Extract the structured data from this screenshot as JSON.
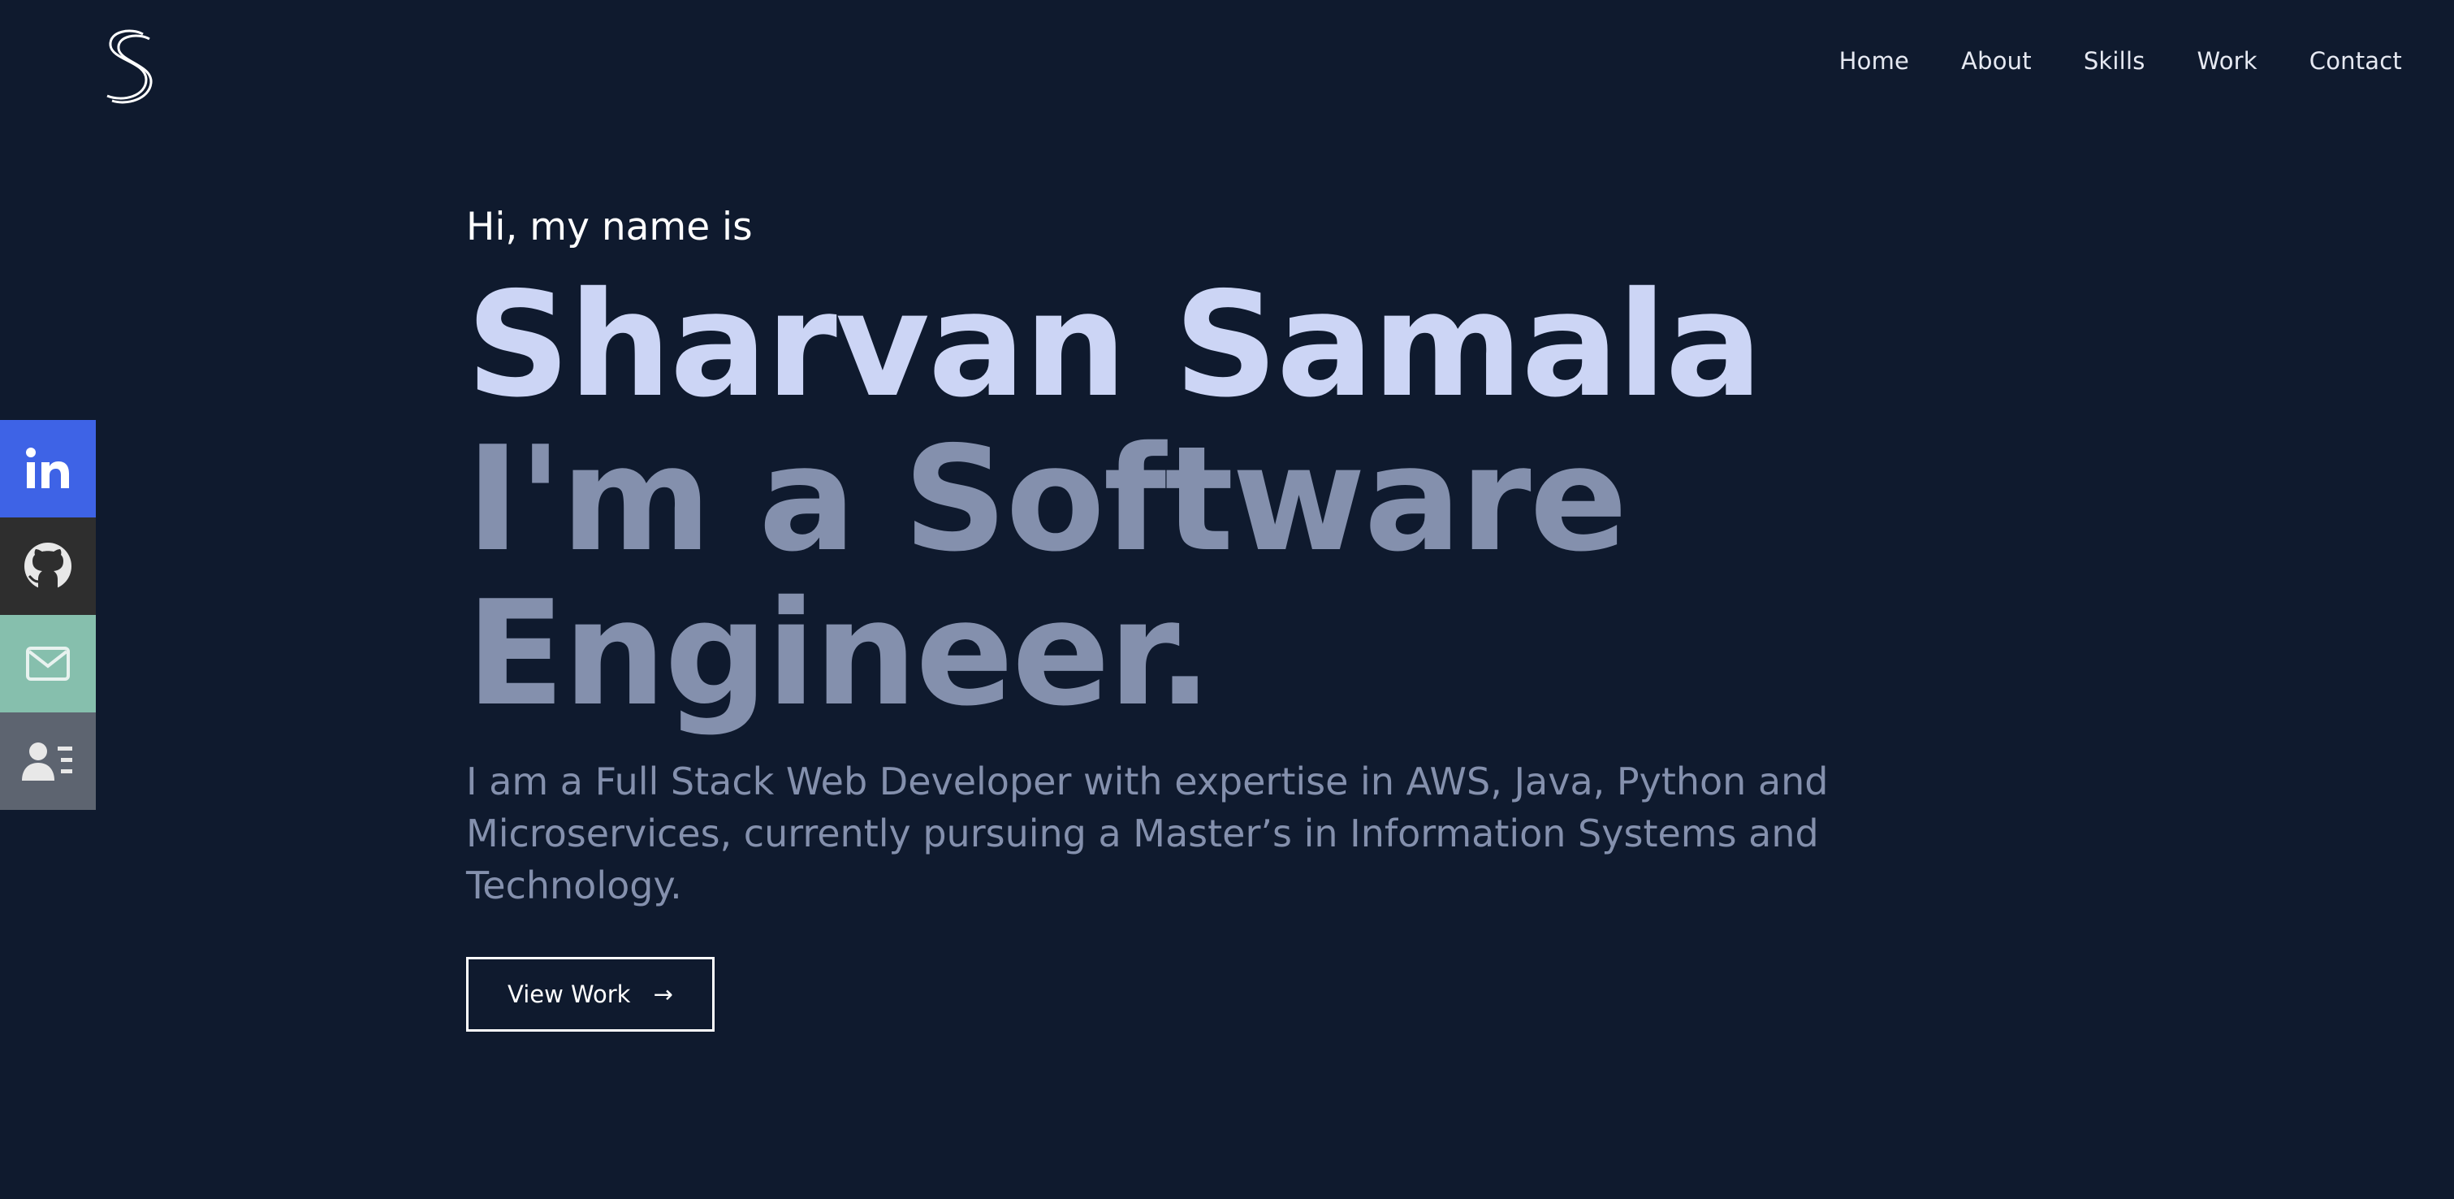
{
  "nav": {
    "items": [
      {
        "label": "Home"
      },
      {
        "label": "About"
      },
      {
        "label": "Skills"
      },
      {
        "label": "Work"
      },
      {
        "label": "Contact"
      }
    ]
  },
  "social": {
    "items": [
      {
        "icon": "linkedin-icon",
        "color": "#3e63e6"
      },
      {
        "icon": "github-icon",
        "color": "#2e2e2e"
      },
      {
        "icon": "mail-icon",
        "color": "#86bfad"
      },
      {
        "icon": "resume-icon",
        "color": "#5d6470"
      }
    ]
  },
  "hero": {
    "greeting": "Hi, my name is",
    "name": "Sharvan Samala",
    "role": "I'm a Software Engineer.",
    "description": "I am a Full Stack Web Developer with expertise in AWS, Java, Python and Microservices, currently pursuing a Master’s in Information Systems and Technology.",
    "cta_label": "View Work",
    "cta_arrow": "→"
  },
  "colors": {
    "background": "#0f1a2e",
    "name": "#ccd5f5",
    "muted": "#8490ad",
    "text": "#ffffff"
  }
}
